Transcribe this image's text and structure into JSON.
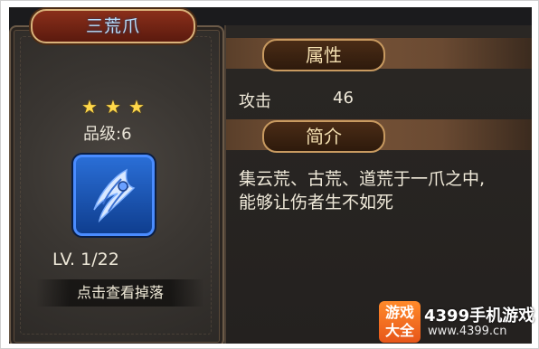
{
  "item": {
    "name": "三荒爪",
    "stars": [
      "★",
      "★",
      "★"
    ],
    "grade_label": "品级:",
    "grade_value": "6",
    "level": "LV. 1/22",
    "drop_button": "点击查看掉落"
  },
  "attributes": {
    "header": "属性",
    "rows": [
      {
        "label": "攻击",
        "value": "46"
      }
    ]
  },
  "intro": {
    "header": "简介",
    "text_line1": "集云荒、古荒、道荒于一爪之中,",
    "text_line2": "能够让伤者生不如死"
  },
  "watermark": {
    "logo_line1": "游戏",
    "logo_line2": "大全",
    "brand": "4399手机游戏",
    "url": "www.4399.cn"
  },
  "colors": {
    "title_text": "#b9e0ff",
    "star": "#ffd84a",
    "icon_bg": "#1e56b8",
    "pill_border": "#c89a60"
  }
}
